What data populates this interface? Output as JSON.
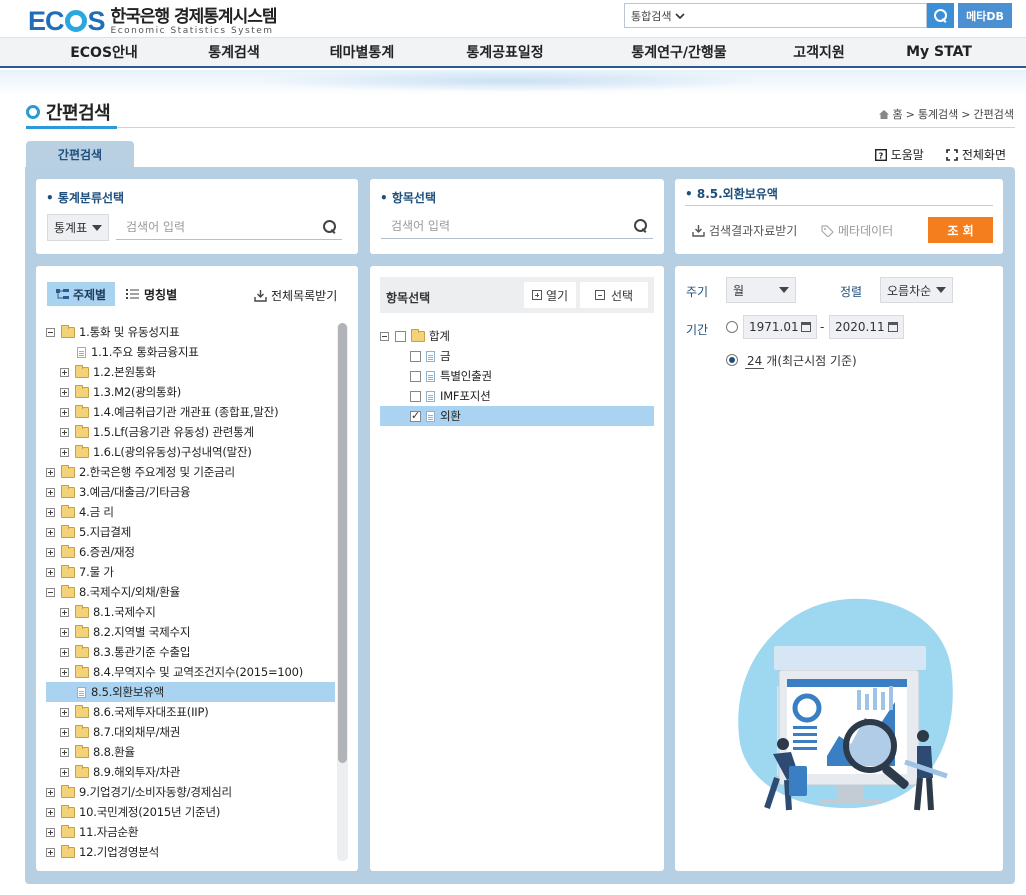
{
  "header": {
    "logo_ecos_pre": "EC",
    "logo_ecos_post": "S",
    "logo_kr": "한국은행 경제통계시스템",
    "logo_en": "Economic Statistics System",
    "search_scope": "통합검색",
    "meta_button": "메타DB"
  },
  "nav": {
    "items": [
      "ECOS안내",
      "통계검색",
      "테마별통계",
      "통계공표일정",
      "통계연구/간행물",
      "고객지원",
      "My STAT"
    ]
  },
  "page": {
    "title": "간편검색",
    "breadcrumb": [
      "홈",
      "통계검색",
      "간편검색"
    ],
    "tab": "간편검색",
    "help": "도움말",
    "fullscreen": "전체화면"
  },
  "classify": {
    "title": "• 통계분류선택",
    "select": "통계표",
    "placeholder": "검색어 입력"
  },
  "item_search": {
    "title": "• 항목선택",
    "placeholder": "검색어 입력"
  },
  "result": {
    "title": "• 8.5.외환보유액",
    "download": "검색결과자료받기",
    "metadata": "메타데이터",
    "query": "조 회"
  },
  "tree_panel": {
    "tab_topic": "주제별",
    "tab_name": "명칭별",
    "download_all": "전체목록받기",
    "rows": [
      {
        "label": "1.통화 및 유동성지표",
        "level": 0,
        "type": "folder",
        "expanded": true
      },
      {
        "label": "1.1.주요 통화금융지표",
        "level": 1,
        "type": "doc"
      },
      {
        "label": "1.2.본원통화",
        "level": 1,
        "type": "folder"
      },
      {
        "label": "1.3.M2(광의통화)",
        "level": 1,
        "type": "folder"
      },
      {
        "label": "1.4.예금취급기관 개관표 (종합표,말잔)",
        "level": 1,
        "type": "folder"
      },
      {
        "label": "1.5.Lf(금융기관 유동성) 관련통계",
        "level": 1,
        "type": "folder"
      },
      {
        "label": "1.6.L(광의유동성)구성내역(말잔)",
        "level": 1,
        "type": "folder"
      },
      {
        "label": "2.한국은행 주요계정 및 기준금리",
        "level": 0,
        "type": "folder"
      },
      {
        "label": "3.예금/대출금/기타금융",
        "level": 0,
        "type": "folder"
      },
      {
        "label": "4.금 리",
        "level": 0,
        "type": "folder"
      },
      {
        "label": "5.지급결제",
        "level": 0,
        "type": "folder"
      },
      {
        "label": "6.증권/재정",
        "level": 0,
        "type": "folder"
      },
      {
        "label": "7.물 가",
        "level": 0,
        "type": "folder"
      },
      {
        "label": "8.국제수지/외채/환율",
        "level": 0,
        "type": "folder",
        "expanded": true
      },
      {
        "label": "8.1.국제수지",
        "level": 1,
        "type": "folder"
      },
      {
        "label": "8.2.지역별 국제수지",
        "level": 1,
        "type": "folder"
      },
      {
        "label": "8.3.통관기준 수출입",
        "level": 1,
        "type": "folder"
      },
      {
        "label": "8.4.무역지수 및 교역조건지수(2015=100)",
        "level": 1,
        "type": "folder"
      },
      {
        "label": "8.5.외환보유액",
        "level": 1,
        "type": "doc",
        "selected": true
      },
      {
        "label": "8.6.국제투자대조표(IIP)",
        "level": 1,
        "type": "folder"
      },
      {
        "label": "8.7.대외채무/채권",
        "level": 1,
        "type": "folder"
      },
      {
        "label": "8.8.환율",
        "level": 1,
        "type": "folder"
      },
      {
        "label": "8.9.해외투자/차관",
        "level": 1,
        "type": "folder"
      },
      {
        "label": "9.기업경기/소비자동향/경제심리",
        "level": 0,
        "type": "folder"
      },
      {
        "label": "10.국민계정(2015년 기준년)",
        "level": 0,
        "type": "folder"
      },
      {
        "label": "11.자금순환",
        "level": 0,
        "type": "folder"
      },
      {
        "label": "12.기업경영분석",
        "level": 0,
        "type": "folder"
      }
    ]
  },
  "item_panel": {
    "header": "항목선택",
    "open_btn": "열기",
    "select_btn": "선택",
    "root": "합계",
    "items": [
      {
        "label": "금",
        "checked": false,
        "selected": false
      },
      {
        "label": "특별인출권",
        "checked": false,
        "selected": false
      },
      {
        "label": "IMF포지션",
        "checked": false,
        "selected": false
      },
      {
        "label": "외환",
        "checked": true,
        "selected": true
      }
    ]
  },
  "options": {
    "cycle_label": "주기",
    "cycle_value": "월",
    "sort_label": "정렬",
    "sort_value": "오름차순",
    "period_label": "기간",
    "start": "1971.01",
    "dash": "-",
    "end": "2020.11",
    "recent_count": "24",
    "recent_suffix": "개(최근시점 기준)",
    "period_mode": "recent"
  },
  "colors": {
    "brand": "#1e6fb8",
    "accent": "#2b9ad6",
    "query_button": "#f47d1e",
    "frame": "#b7cfe2",
    "selected_row": "#a9d3f0"
  }
}
